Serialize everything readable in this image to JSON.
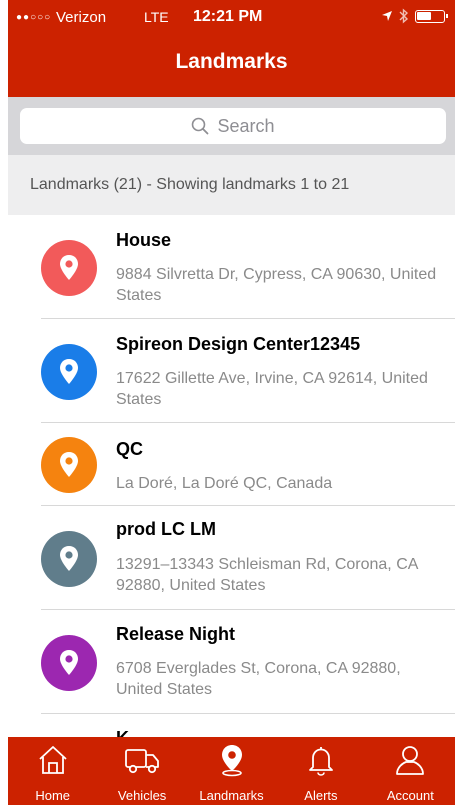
{
  "status_bar": {
    "signal": "●●○○○",
    "carrier": "Verizon",
    "network": "LTE",
    "time": "12:21 PM"
  },
  "nav": {
    "title": "Landmarks"
  },
  "search": {
    "placeholder": "Search"
  },
  "section": {
    "header": "Landmarks (21) - Showing landmarks 1 to 21"
  },
  "landmarks": [
    {
      "name": "House",
      "address": "9884 Silvretta Dr, Cypress, CA 90630, United States",
      "color": "#f25a5a"
    },
    {
      "name": "Spireon Design Center12345",
      "address": "17622 Gillette Ave, Irvine, CA  92614, United States",
      "color": "#1a7de8"
    },
    {
      "name": "QC",
      "address": "La Doré, La Doré QC, Canada",
      "color": "#f5830f"
    },
    {
      "name": "prod LC LM",
      "address": "13291–13343 Schleisman Rd, Corona, CA  92880, United States",
      "color": "#607d8b"
    },
    {
      "name": "Release Night",
      "address": "6708 Everglades St, Corona, CA 92880, United States",
      "color": "#9c27b0"
    },
    {
      "name": "K",
      "address": "",
      "color": "#607d8b"
    }
  ],
  "tabs": [
    {
      "label": "Home",
      "icon": "home-icon"
    },
    {
      "label": "Vehicles",
      "icon": "truck-icon"
    },
    {
      "label": "Landmarks",
      "icon": "location-pin-icon",
      "active": true
    },
    {
      "label": "Alerts",
      "icon": "bell-icon"
    },
    {
      "label": "Account",
      "icon": "person-icon"
    }
  ],
  "colors": {
    "brand_red": "#cc2200",
    "search_bg": "#d6d6d9",
    "section_bg": "#eeeeef"
  }
}
